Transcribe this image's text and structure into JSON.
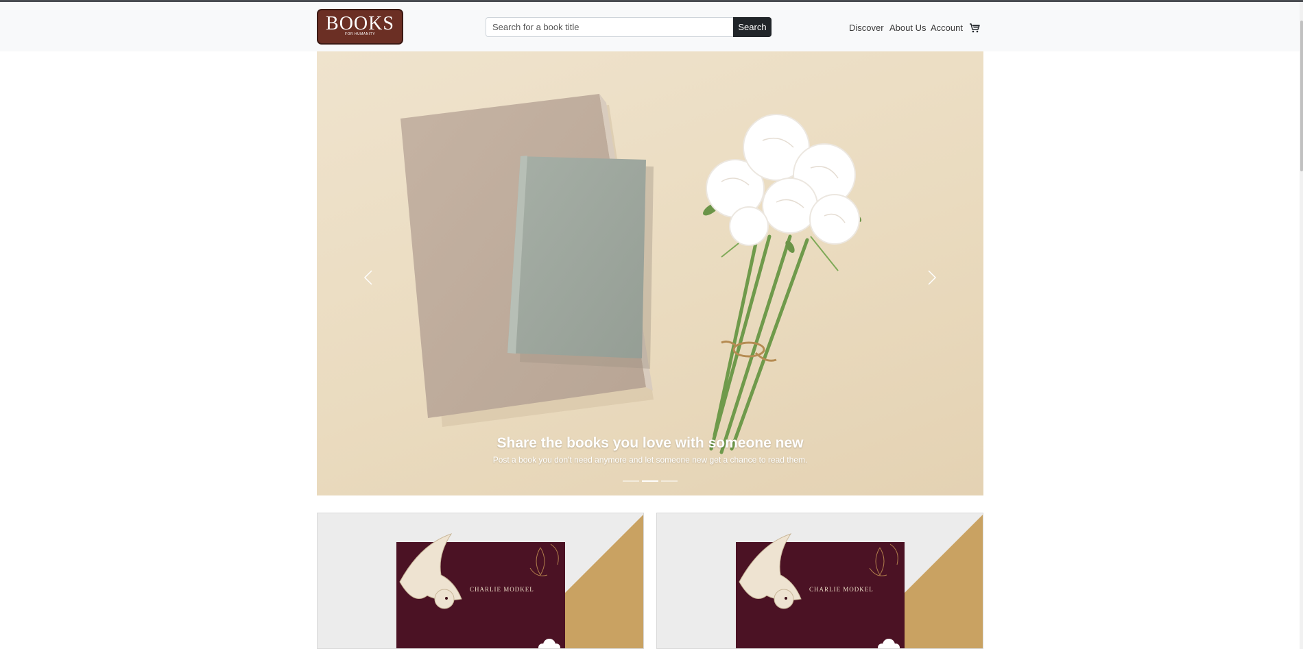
{
  "brand": {
    "logo_main": "BOOKS",
    "logo_sub": "FOR HUMANITY",
    "colors": {
      "logo_bg": "#6b2f24",
      "nav_bg": "#f8f9fa",
      "search_button": "#212529"
    }
  },
  "search": {
    "placeholder": "Search for a book title",
    "button_label": "Search"
  },
  "nav": {
    "links": [
      "Discover",
      "About Us",
      "Account"
    ],
    "cart_icon": "cart-icon"
  },
  "carousel": {
    "title": "Share the books you love with someone new",
    "subtitle": "Post a book you don't need anymore and let someone new get a chance to read them.",
    "slide_count": 3,
    "active_index": 1,
    "prev_icon": "chevron-left-icon",
    "next_icon": "chevron-right-icon"
  },
  "cards": [
    {
      "author": "CHARLIE MODKEL"
    },
    {
      "author": "CHARLIE MODKEL"
    }
  ]
}
